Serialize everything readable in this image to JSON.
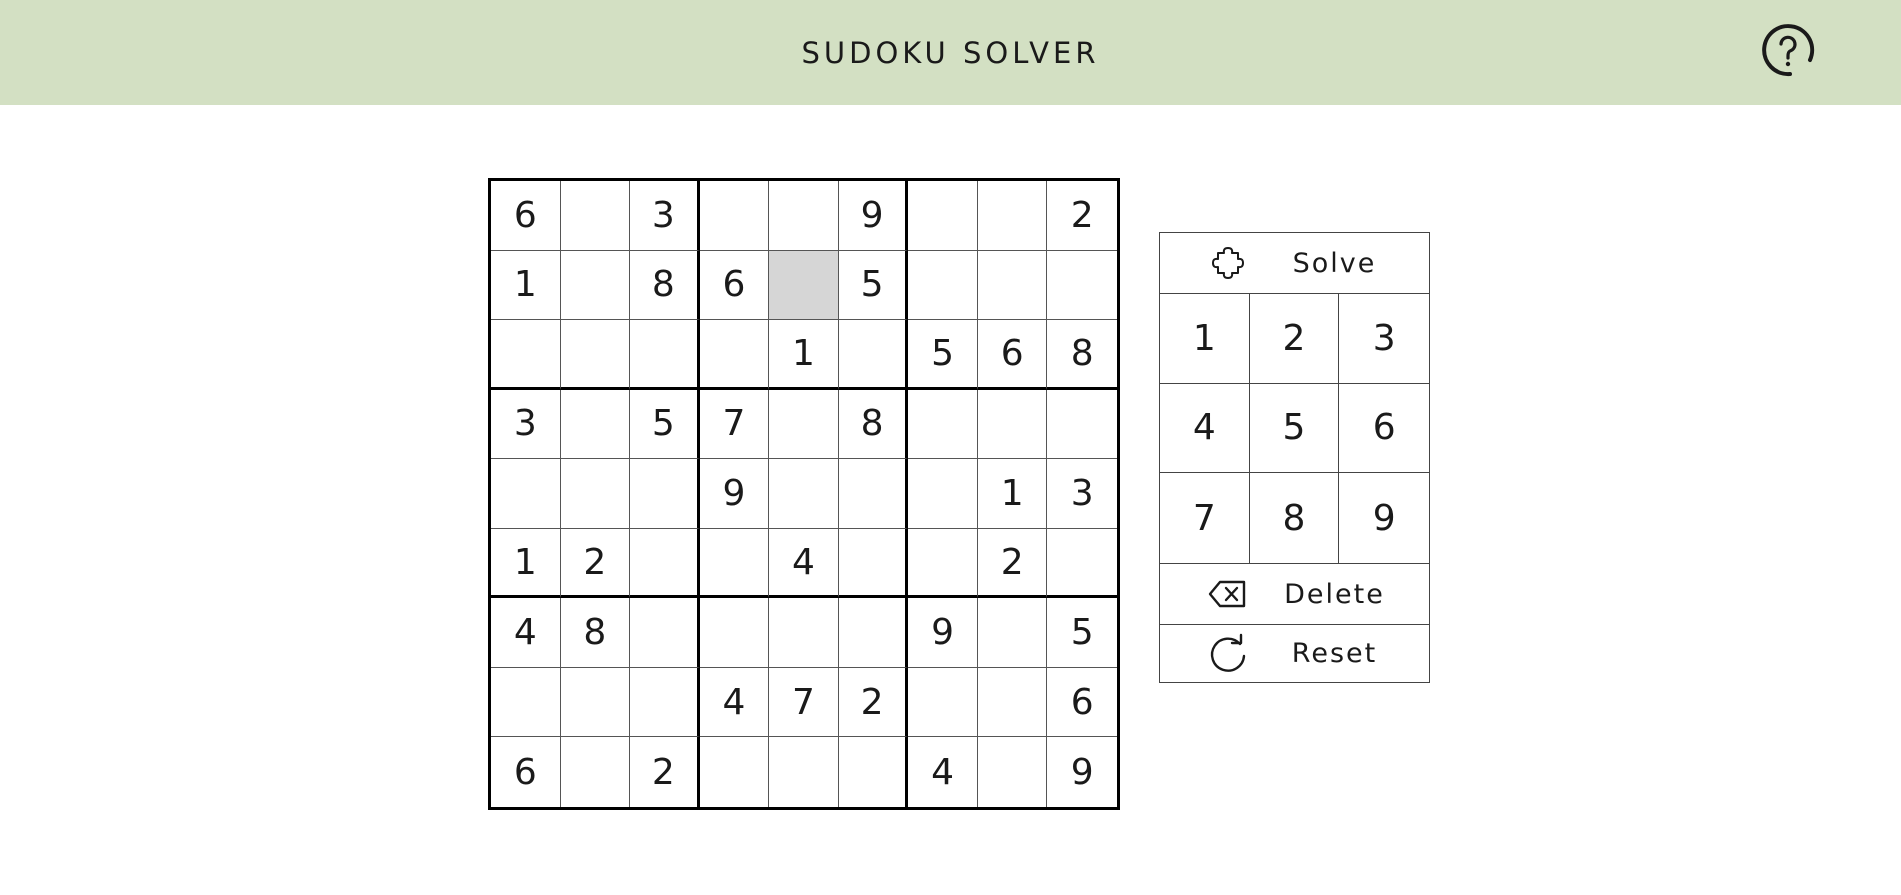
{
  "header": {
    "title": "SUDOKU SOLVER",
    "help_icon": "question-circle-icon",
    "background": "#d3e0c3"
  },
  "board": {
    "selected_cell": {
      "row": 1,
      "col": 4
    },
    "selected_color": "#d6d6d6",
    "cells": [
      [
        "6",
        "",
        "3",
        "",
        "",
        "9",
        "",
        "",
        "2"
      ],
      [
        "1",
        "",
        "8",
        "6",
        "",
        "5",
        "",
        "",
        ""
      ],
      [
        "",
        "",
        "",
        "",
        "1",
        "",
        "5",
        "6",
        "8"
      ],
      [
        "3",
        "",
        "5",
        "7",
        "",
        "8",
        "",
        "",
        ""
      ],
      [
        "",
        "",
        "",
        "9",
        "",
        "",
        "",
        "1",
        "3"
      ],
      [
        "1",
        "2",
        "",
        "",
        "4",
        "",
        "",
        "2",
        ""
      ],
      [
        "4",
        "8",
        "",
        "",
        "",
        "",
        "9",
        "",
        "5"
      ],
      [
        "",
        "",
        "",
        "4",
        "7",
        "2",
        "",
        "",
        "6"
      ],
      [
        "6",
        "",
        "2",
        "",
        "",
        "",
        "4",
        "",
        "9"
      ]
    ]
  },
  "panel": {
    "solve_label": "Solve",
    "solve_icon": "puzzle-piece-icon",
    "numbers": [
      "1",
      "2",
      "3",
      "4",
      "5",
      "6",
      "7",
      "8",
      "9"
    ],
    "delete_label": "Delete",
    "delete_icon": "backspace-icon",
    "reset_label": "Reset",
    "reset_icon": "refresh-icon"
  }
}
